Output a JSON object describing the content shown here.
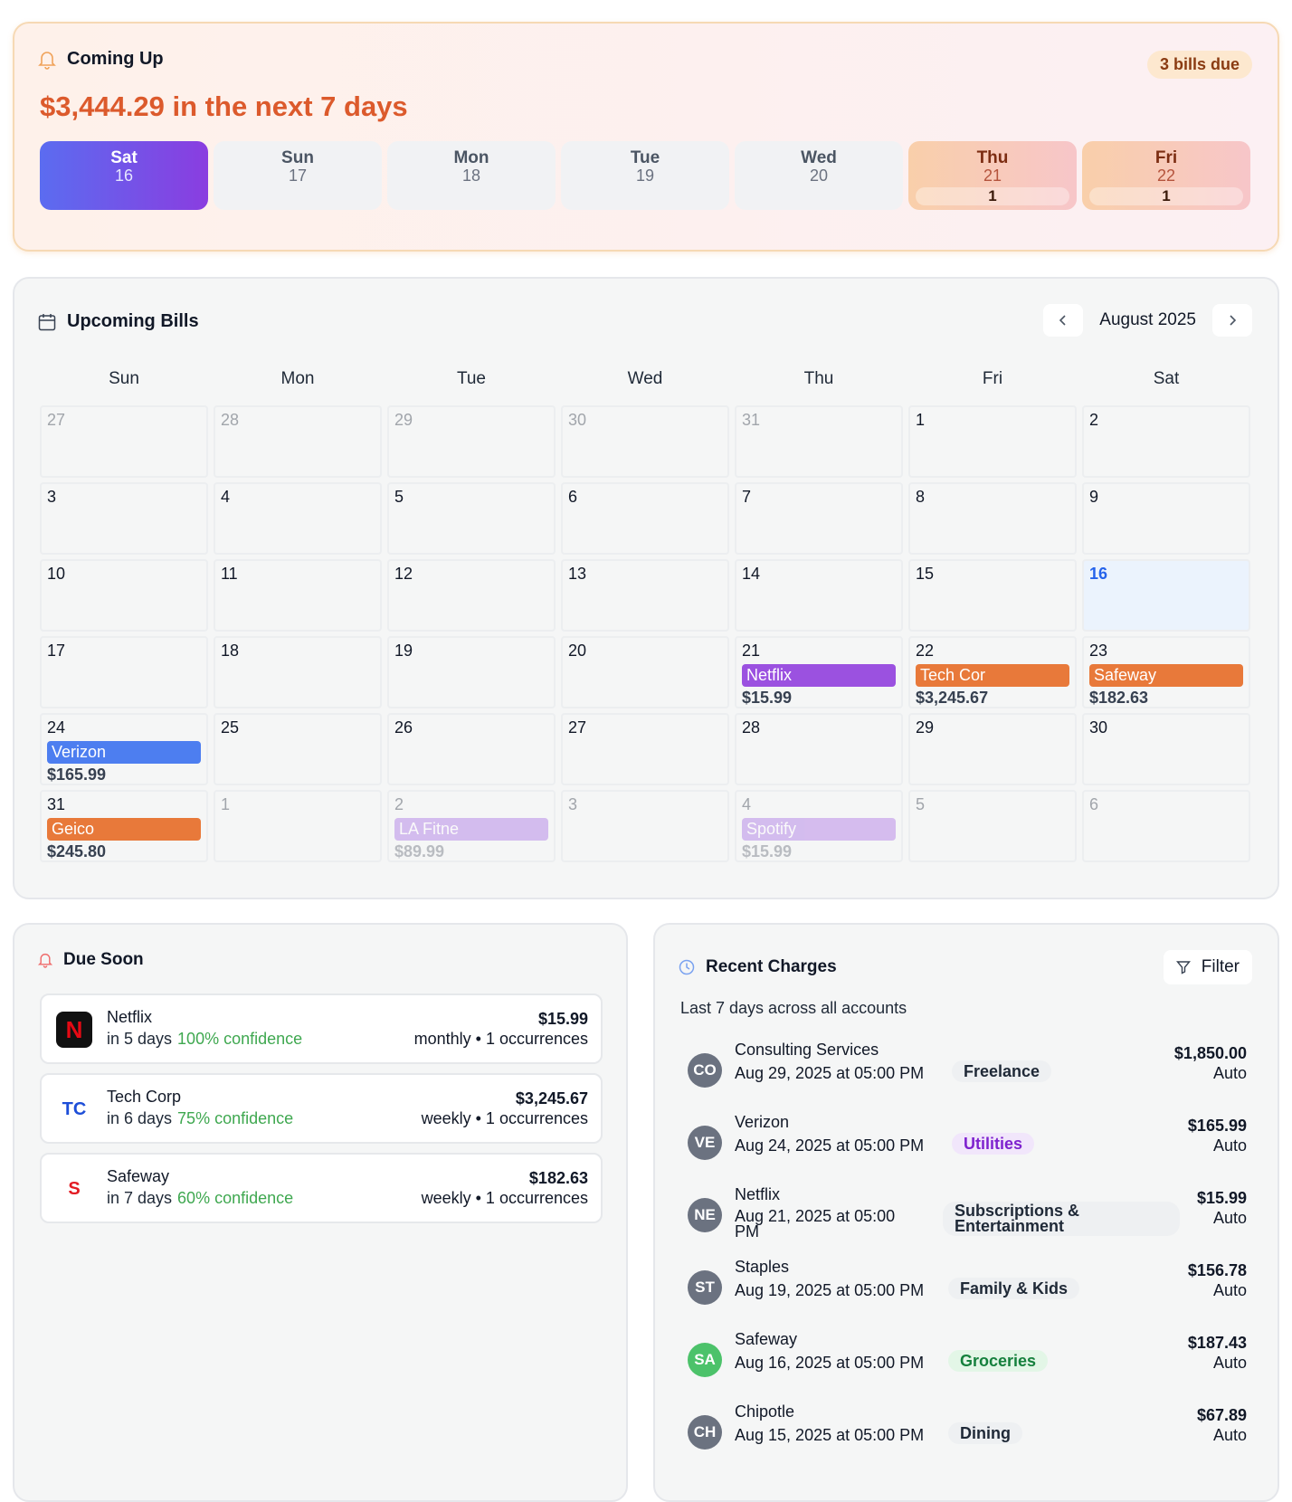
{
  "coming_up": {
    "title": "Coming Up",
    "badge": "3 bills due",
    "total": "$3,444.29 in the next 7 days",
    "days": [
      {
        "name": "Sat",
        "date": "16",
        "count": ""
      },
      {
        "name": "Sun",
        "date": "17",
        "count": ""
      },
      {
        "name": "Mon",
        "date": "18",
        "count": ""
      },
      {
        "name": "Tue",
        "date": "19",
        "count": ""
      },
      {
        "name": "Wed",
        "date": "20",
        "count": ""
      },
      {
        "name": "Thu",
        "date": "21",
        "count": "1"
      },
      {
        "name": "Fri",
        "date": "22",
        "count": "1"
      }
    ]
  },
  "calendar": {
    "title": "Upcoming Bills",
    "month": "August 2025",
    "weekdays": [
      "Sun",
      "Mon",
      "Tue",
      "Wed",
      "Thu",
      "Fri",
      "Sat"
    ],
    "cells": [
      {
        "day": "27",
        "muted": true
      },
      {
        "day": "28",
        "muted": true
      },
      {
        "day": "29",
        "muted": true
      },
      {
        "day": "30",
        "muted": true
      },
      {
        "day": "31",
        "muted": true
      },
      {
        "day": "1"
      },
      {
        "day": "2"
      },
      {
        "day": "3"
      },
      {
        "day": "4"
      },
      {
        "day": "5"
      },
      {
        "day": "6"
      },
      {
        "day": "7"
      },
      {
        "day": "8"
      },
      {
        "day": "9"
      },
      {
        "day": "10"
      },
      {
        "day": "11"
      },
      {
        "day": "12"
      },
      {
        "day": "13"
      },
      {
        "day": "14"
      },
      {
        "day": "15"
      },
      {
        "day": "16",
        "today": true
      },
      {
        "day": "17"
      },
      {
        "day": "18"
      },
      {
        "day": "19"
      },
      {
        "day": "20"
      },
      {
        "day": "21",
        "event": "Netflix",
        "amount": "$15.99",
        "color": "#9b51e0"
      },
      {
        "day": "22",
        "event": "Tech Cor",
        "amount": "$3,245.67",
        "color": "#e8793a"
      },
      {
        "day": "23",
        "event": "Safeway",
        "amount": "$182.63",
        "color": "#e8793a"
      },
      {
        "day": "24",
        "event": "Verizon",
        "amount": "$165.99",
        "color": "#4d7ef0"
      },
      {
        "day": "25"
      },
      {
        "day": "26"
      },
      {
        "day": "27"
      },
      {
        "day": "28"
      },
      {
        "day": "29"
      },
      {
        "day": "30"
      },
      {
        "day": "31",
        "event": "Geico",
        "amount": "$245.80",
        "color": "#e8793a"
      },
      {
        "day": "1",
        "muted": true
      },
      {
        "day": "2",
        "muted": true,
        "event": "LA Fitne",
        "amount": "$89.99",
        "color": "#b98de8"
      },
      {
        "day": "3",
        "muted": true
      },
      {
        "day": "4",
        "muted": true,
        "event": "Spotify",
        "amount": "$15.99",
        "color": "#b98de8"
      },
      {
        "day": "5",
        "muted": true
      },
      {
        "day": "6",
        "muted": true
      }
    ]
  },
  "due_soon": {
    "title": "Due Soon",
    "items": [
      {
        "name": "Netflix",
        "when": "in 5 days",
        "confidence": "100% confidence",
        "amount": "$15.99",
        "freq": "monthly • 1 occurrences",
        "logo": "N",
        "logo_bg": "#111111",
        "logo_fg": "#e50914"
      },
      {
        "name": "Tech Corp",
        "when": "in 6 days",
        "confidence": "75% confidence",
        "amount": "$3,245.67",
        "freq": "weekly • 1 occurrences",
        "logo": "TC",
        "logo_bg": "#ffffff",
        "logo_fg": "#1d4ed8"
      },
      {
        "name": "Safeway",
        "when": "in 7 days",
        "confidence": "60% confidence",
        "amount": "$182.63",
        "freq": "weekly • 1 occurrences",
        "logo": "S",
        "logo_bg": "#ffffff",
        "logo_fg": "#e31b23"
      }
    ]
  },
  "recent": {
    "title": "Recent Charges",
    "filter": "Filter",
    "subtitle": "Last 7 days across all accounts",
    "items": [
      {
        "initials": "CO",
        "name": "Consulting Services",
        "date": "Aug 29, 2025 at 05:00 PM",
        "tag": "Freelance",
        "amount": "$1,850.00",
        "type": "Auto",
        "av": "#6b7280",
        "tag_bg": "#eef0f2",
        "tag_fg": "#1f2937"
      },
      {
        "initials": "VE",
        "name": "Verizon",
        "date": "Aug 24, 2025 at 05:00 PM",
        "tag": "Utilities",
        "amount": "$165.99",
        "type": "Auto",
        "av": "#6b7280",
        "tag_bg": "#f1e6fb",
        "tag_fg": "#7e22ce"
      },
      {
        "initials": "NE",
        "name": "Netflix",
        "date": "Aug 21, 2025 at 05:00 PM",
        "tag": "Subscriptions & Entertainment",
        "amount": "$15.99",
        "type": "Auto",
        "av": "#6b7280",
        "tag_bg": "#eef0f2",
        "tag_fg": "#1f2937"
      },
      {
        "initials": "ST",
        "name": "Staples",
        "date": "Aug 19, 2025 at 05:00 PM",
        "tag": "Family & Kids",
        "amount": "$156.78",
        "type": "Auto",
        "av": "#6b7280",
        "tag_bg": "#eef0f2",
        "tag_fg": "#1f2937"
      },
      {
        "initials": "SA",
        "name": "Safeway",
        "date": "Aug 16, 2025 at 05:00 PM",
        "tag": "Groceries",
        "amount": "$187.43",
        "type": "Auto",
        "av": "#4cc26a",
        "tag_bg": "#e3f6e7",
        "tag_fg": "#15803d"
      },
      {
        "initials": "CH",
        "name": "Chipotle",
        "date": "Aug 15, 2025 at 05:00 PM",
        "tag": "Dining",
        "amount": "$67.89",
        "type": "Auto",
        "av": "#6b7280",
        "tag_bg": "#eef0f2",
        "tag_fg": "#1f2937"
      }
    ]
  },
  "icons": {
    "bell": "bell-icon",
    "calendar": "calendar-icon",
    "clock": "clock-icon",
    "filter": "filter-icon",
    "prev": "chevron-left-icon",
    "next": "chevron-right-icon"
  }
}
